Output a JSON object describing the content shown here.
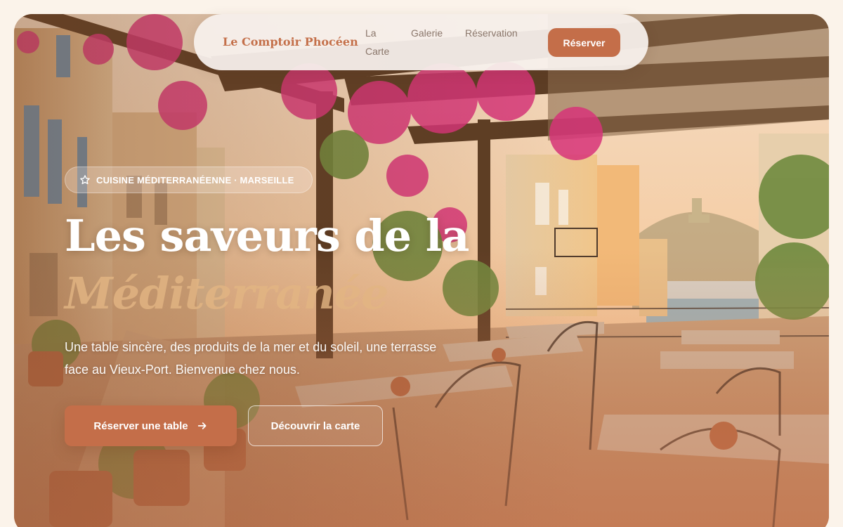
{
  "brand": "Le Comptoir Phocéen",
  "nav": {
    "links": [
      "La Carte",
      "Galerie",
      "Réservation"
    ],
    "cta": "Réserver"
  },
  "hero": {
    "badge": "CUISINE MÉDITERRANÉENNE · MARSEILLE",
    "badge_icon": "star-icon",
    "headline": "Les saveurs de la",
    "headline_accent": "Méditerranée",
    "lead": "Une table sincère, des produits de la mer et du soleil, une terrasse face au Vieux-Port. Bienvenue chez nous.",
    "primary_button": "Réserver une table",
    "primary_button_icon": "arrow-right-icon",
    "secondary_button": "Découvrir la carte"
  },
  "colors": {
    "accent": "#c46e49",
    "page_background": "#fbf3ea",
    "brand_text": "#c4704a",
    "nav_text": "#8a766a",
    "headline_accent": "#e2b482"
  }
}
